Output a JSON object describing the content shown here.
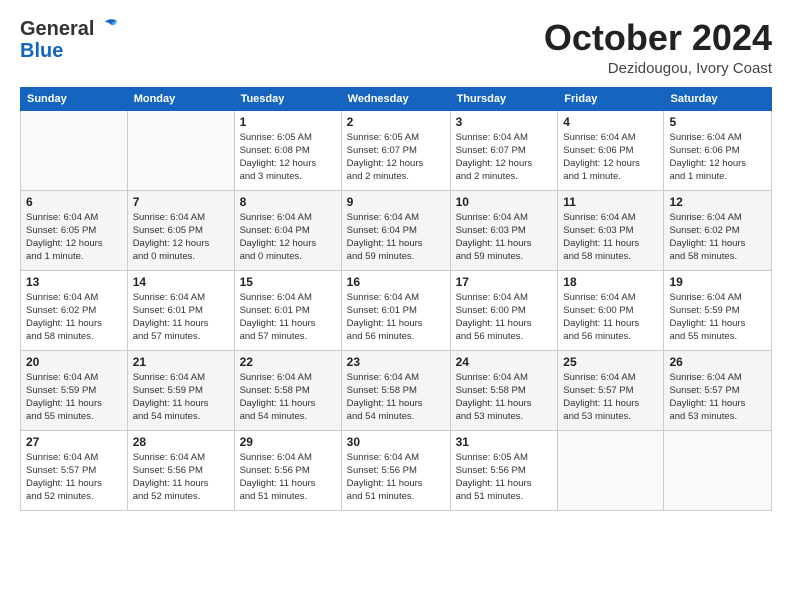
{
  "header": {
    "logo_line1": "General",
    "logo_line2": "Blue",
    "month_title": "October 2024",
    "location": "Dezidougou, Ivory Coast"
  },
  "weekdays": [
    "Sunday",
    "Monday",
    "Tuesday",
    "Wednesday",
    "Thursday",
    "Friday",
    "Saturday"
  ],
  "weeks": [
    [
      {
        "day": "",
        "info": ""
      },
      {
        "day": "",
        "info": ""
      },
      {
        "day": "1",
        "info": "Sunrise: 6:05 AM\nSunset: 6:08 PM\nDaylight: 12 hours\nand 3 minutes."
      },
      {
        "day": "2",
        "info": "Sunrise: 6:05 AM\nSunset: 6:07 PM\nDaylight: 12 hours\nand 2 minutes."
      },
      {
        "day": "3",
        "info": "Sunrise: 6:04 AM\nSunset: 6:07 PM\nDaylight: 12 hours\nand 2 minutes."
      },
      {
        "day": "4",
        "info": "Sunrise: 6:04 AM\nSunset: 6:06 PM\nDaylight: 12 hours\nand 1 minute."
      },
      {
        "day": "5",
        "info": "Sunrise: 6:04 AM\nSunset: 6:06 PM\nDaylight: 12 hours\nand 1 minute."
      }
    ],
    [
      {
        "day": "6",
        "info": "Sunrise: 6:04 AM\nSunset: 6:05 PM\nDaylight: 12 hours\nand 1 minute."
      },
      {
        "day": "7",
        "info": "Sunrise: 6:04 AM\nSunset: 6:05 PM\nDaylight: 12 hours\nand 0 minutes."
      },
      {
        "day": "8",
        "info": "Sunrise: 6:04 AM\nSunset: 6:04 PM\nDaylight: 12 hours\nand 0 minutes."
      },
      {
        "day": "9",
        "info": "Sunrise: 6:04 AM\nSunset: 6:04 PM\nDaylight: 11 hours\nand 59 minutes."
      },
      {
        "day": "10",
        "info": "Sunrise: 6:04 AM\nSunset: 6:03 PM\nDaylight: 11 hours\nand 59 minutes."
      },
      {
        "day": "11",
        "info": "Sunrise: 6:04 AM\nSunset: 6:03 PM\nDaylight: 11 hours\nand 58 minutes."
      },
      {
        "day": "12",
        "info": "Sunrise: 6:04 AM\nSunset: 6:02 PM\nDaylight: 11 hours\nand 58 minutes."
      }
    ],
    [
      {
        "day": "13",
        "info": "Sunrise: 6:04 AM\nSunset: 6:02 PM\nDaylight: 11 hours\nand 58 minutes."
      },
      {
        "day": "14",
        "info": "Sunrise: 6:04 AM\nSunset: 6:01 PM\nDaylight: 11 hours\nand 57 minutes."
      },
      {
        "day": "15",
        "info": "Sunrise: 6:04 AM\nSunset: 6:01 PM\nDaylight: 11 hours\nand 57 minutes."
      },
      {
        "day": "16",
        "info": "Sunrise: 6:04 AM\nSunset: 6:01 PM\nDaylight: 11 hours\nand 56 minutes."
      },
      {
        "day": "17",
        "info": "Sunrise: 6:04 AM\nSunset: 6:00 PM\nDaylight: 11 hours\nand 56 minutes."
      },
      {
        "day": "18",
        "info": "Sunrise: 6:04 AM\nSunset: 6:00 PM\nDaylight: 11 hours\nand 56 minutes."
      },
      {
        "day": "19",
        "info": "Sunrise: 6:04 AM\nSunset: 5:59 PM\nDaylight: 11 hours\nand 55 minutes."
      }
    ],
    [
      {
        "day": "20",
        "info": "Sunrise: 6:04 AM\nSunset: 5:59 PM\nDaylight: 11 hours\nand 55 minutes."
      },
      {
        "day": "21",
        "info": "Sunrise: 6:04 AM\nSunset: 5:59 PM\nDaylight: 11 hours\nand 54 minutes."
      },
      {
        "day": "22",
        "info": "Sunrise: 6:04 AM\nSunset: 5:58 PM\nDaylight: 11 hours\nand 54 minutes."
      },
      {
        "day": "23",
        "info": "Sunrise: 6:04 AM\nSunset: 5:58 PM\nDaylight: 11 hours\nand 54 minutes."
      },
      {
        "day": "24",
        "info": "Sunrise: 6:04 AM\nSunset: 5:58 PM\nDaylight: 11 hours\nand 53 minutes."
      },
      {
        "day": "25",
        "info": "Sunrise: 6:04 AM\nSunset: 5:57 PM\nDaylight: 11 hours\nand 53 minutes."
      },
      {
        "day": "26",
        "info": "Sunrise: 6:04 AM\nSunset: 5:57 PM\nDaylight: 11 hours\nand 53 minutes."
      }
    ],
    [
      {
        "day": "27",
        "info": "Sunrise: 6:04 AM\nSunset: 5:57 PM\nDaylight: 11 hours\nand 52 minutes."
      },
      {
        "day": "28",
        "info": "Sunrise: 6:04 AM\nSunset: 5:56 PM\nDaylight: 11 hours\nand 52 minutes."
      },
      {
        "day": "29",
        "info": "Sunrise: 6:04 AM\nSunset: 5:56 PM\nDaylight: 11 hours\nand 51 minutes."
      },
      {
        "day": "30",
        "info": "Sunrise: 6:04 AM\nSunset: 5:56 PM\nDaylight: 11 hours\nand 51 minutes."
      },
      {
        "day": "31",
        "info": "Sunrise: 6:05 AM\nSunset: 5:56 PM\nDaylight: 11 hours\nand 51 minutes."
      },
      {
        "day": "",
        "info": ""
      },
      {
        "day": "",
        "info": ""
      }
    ]
  ]
}
